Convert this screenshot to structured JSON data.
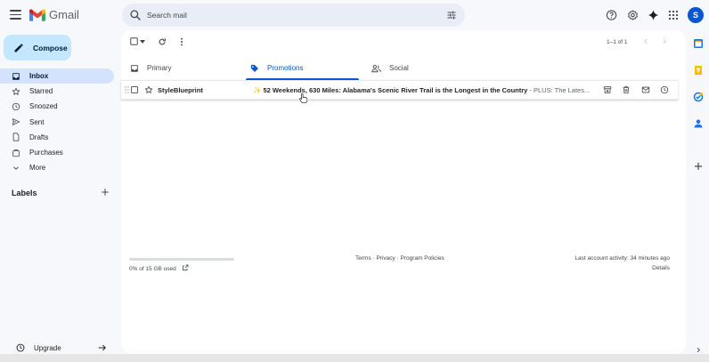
{
  "app": {
    "name": "Gmail"
  },
  "search": {
    "placeholder": "Search mail"
  },
  "compose": {
    "label": "Compose"
  },
  "nav": [
    {
      "label": "Inbox",
      "icon": "inbox-icon",
      "active": true
    },
    {
      "label": "Starred",
      "icon": "star-icon"
    },
    {
      "label": "Snoozed",
      "icon": "clock-icon"
    },
    {
      "label": "Sent",
      "icon": "send-icon"
    },
    {
      "label": "Drafts",
      "icon": "draft-icon"
    },
    {
      "label": "Purchases",
      "icon": "purchases-icon"
    },
    {
      "label": "More",
      "icon": "chevron-down-icon"
    }
  ],
  "labels": {
    "heading": "Labels"
  },
  "upgrade": {
    "label": "Upgrade"
  },
  "user": {
    "initial": "S",
    "avatar_color": "#0b57d0"
  },
  "toolbar": {
    "pager": "1–1 of 1"
  },
  "tabs": [
    {
      "label": "Primary",
      "icon": "inbox-tab-icon"
    },
    {
      "label": "Promotions",
      "icon": "tag-icon",
      "active": true
    },
    {
      "label": "Social",
      "icon": "people-icon"
    }
  ],
  "email": {
    "sender": "StyleBlueprint",
    "subject_prefix": "✨",
    "subject": "52 Weekends, 630 Miles: Alabama's Scenic River Trail is the Longest in the Country",
    "snippet": "- PLUS: The Lates..."
  },
  "footer": {
    "storage": "0% of 15 GB used",
    "links": "Terms · Privacy · Program Policies",
    "activity": "Last account activity: 34 minutes ago",
    "details": "Details"
  },
  "colors": {
    "accent": "#0b57d0",
    "compose_bg": "#c2e7ff",
    "active_nav": "#d3e3fd"
  }
}
